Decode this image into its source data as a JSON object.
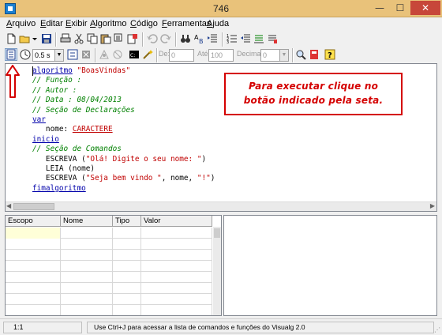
{
  "window": {
    "title": "746",
    "min_glyph": "—",
    "max_glyph": "☐",
    "close_glyph": "✕"
  },
  "menu": {
    "items": [
      {
        "label": "Arquivo"
      },
      {
        "label": "Editar"
      },
      {
        "label": "Exibir"
      },
      {
        "label": "Algoritmo"
      },
      {
        "label": "Código"
      },
      {
        "label": "Ferramentas"
      },
      {
        "label": "Ajuda"
      }
    ]
  },
  "toolbar2": {
    "speed_value": "0.5 s",
    "label_de": "De:",
    "de_value": "0",
    "label_ate": "Até:",
    "ate_value": "100",
    "label_decimais": "Decimais:",
    "decimais_value": "0"
  },
  "editor": {
    "lines": [
      [
        {
          "t": "algoritmo",
          "c": "kw"
        },
        {
          "t": " "
        },
        {
          "t": "\"BoasVindas\"",
          "c": "str"
        }
      ],
      [
        {
          "t": "// Função :",
          "c": "cm"
        }
      ],
      [
        {
          "t": "// Autor :",
          "c": "cm"
        }
      ],
      [
        {
          "t": "// Data : 08/04/2013",
          "c": "cm"
        }
      ],
      [
        {
          "t": "// Seção de Declarações",
          "c": "cm"
        }
      ],
      [
        {
          "t": "var",
          "c": "kw"
        }
      ],
      [
        {
          "t": "   nome: "
        },
        {
          "t": "CARACTERE",
          "c": "ty"
        }
      ],
      [
        {
          "t": "inicio",
          "c": "kw"
        }
      ],
      [
        {
          "t": "// Seção de Comandos",
          "c": "cm"
        }
      ],
      [
        {
          "t": "   ESCREVA ("
        },
        {
          "t": "\"Olá! Digite o seu nome: \"",
          "c": "str"
        },
        {
          "t": ")"
        }
      ],
      [
        {
          "t": "   LEIA (nome)"
        }
      ],
      [
        {
          "t": "   ESCREVA ("
        },
        {
          "t": "\"Seja bem vindo \"",
          "c": "str"
        },
        {
          "t": ", nome, "
        },
        {
          "t": "\"!\"",
          "c": "str"
        },
        {
          "t": ")"
        }
      ],
      [
        {
          "t": "fimalgoritmo",
          "c": "kw"
        }
      ]
    ]
  },
  "annotation": {
    "line1": "Para executar clique no",
    "line2": "botão indicado pela seta."
  },
  "variables": {
    "columns": [
      "Escopo",
      "Nome",
      "Tipo",
      "Valor"
    ]
  },
  "status": {
    "position": "1:1",
    "message": "Use Ctrl+J para acessar a lista de comandos e funções do Visualg 2.0"
  },
  "colors": {
    "keyword": "#0000aa",
    "comment": "#008000",
    "string": "#c00000",
    "annotation": "#d40000",
    "titlebar": "#e9c27a"
  }
}
